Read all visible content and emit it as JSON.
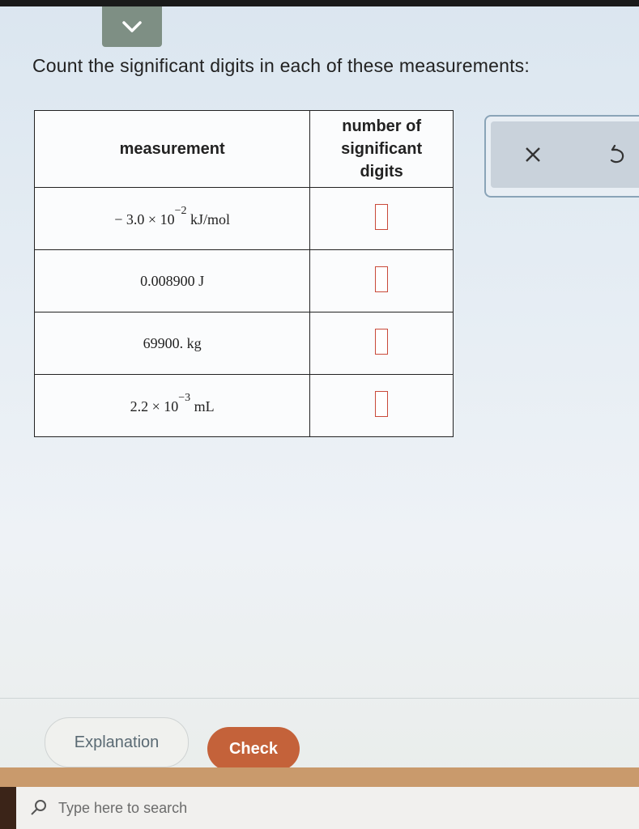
{
  "prompt": "Count the significant digits in each of these measurements:",
  "table": {
    "header_measurement": "measurement",
    "header_number_lines": [
      "number of",
      "significant",
      "digits"
    ],
    "rows": [
      {
        "parts": [
          "− 3.0 × 10",
          "−2",
          " kJ/mol"
        ]
      },
      {
        "parts": [
          "0.008900 J"
        ]
      },
      {
        "parts": [
          "69900. kg"
        ]
      },
      {
        "parts": [
          "2.2 × 10",
          "−3",
          " mL"
        ]
      }
    ]
  },
  "tools": {
    "clear_icon": "close-icon",
    "undo_icon": "undo-icon"
  },
  "buttons": {
    "explanation": "Explanation",
    "check": "Check"
  },
  "taskbar": {
    "search_placeholder": "Type here to search"
  },
  "colors": {
    "check_button": "#c4623a",
    "answer_box_border": "#c94a3a",
    "collapse_tab": "#7e8f84"
  }
}
